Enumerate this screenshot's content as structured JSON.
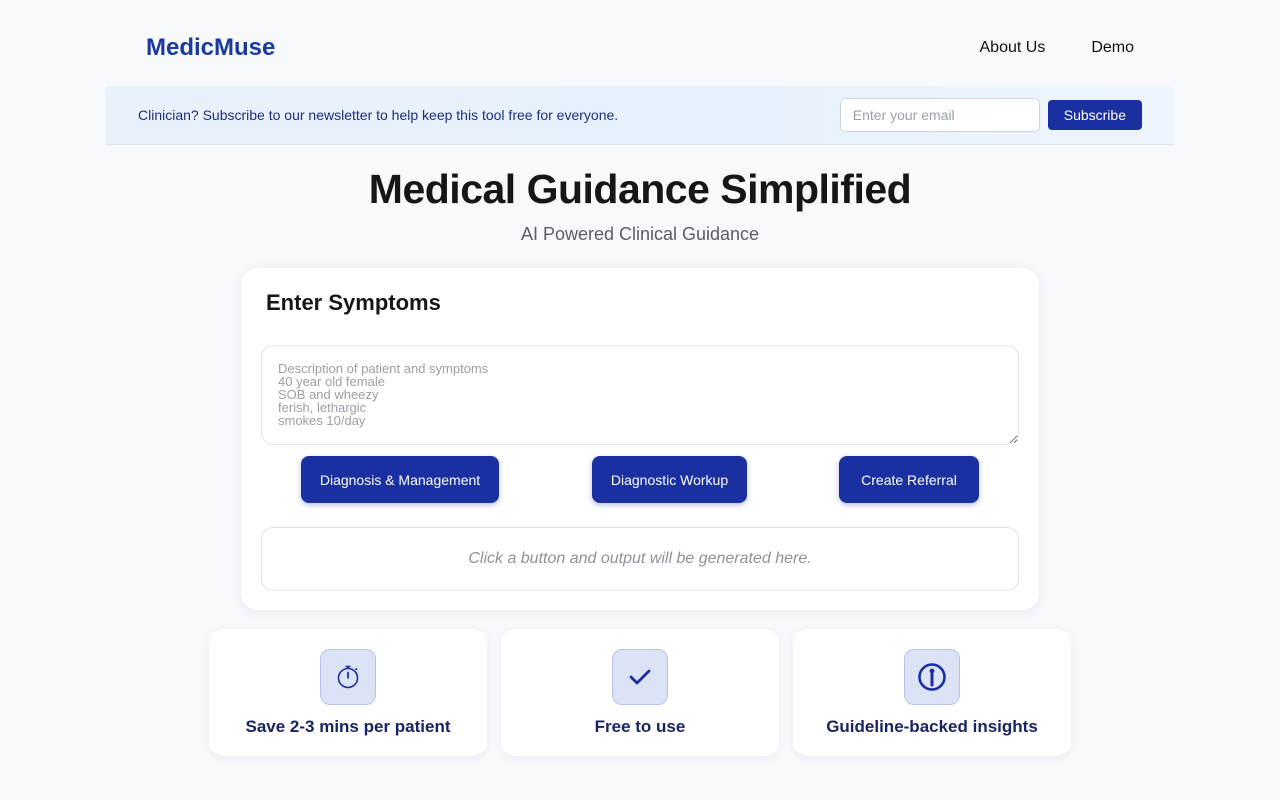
{
  "header": {
    "brand": "MedicMuse",
    "nav": [
      {
        "label": "About Us"
      },
      {
        "label": "Demo"
      }
    ]
  },
  "newsletter": {
    "text": "Clinician? Subscribe to our newsletter to help keep this tool free for everyone.",
    "email_placeholder": "Enter your email",
    "subscribe_label": "Subscribe"
  },
  "hero": {
    "title": "Medical Guidance Simplified",
    "subtitle": "AI Powered Clinical Guidance"
  },
  "symptoms_card": {
    "title": "Enter Symptoms",
    "textarea_placeholder": "Description of patient and symptoms\n40 year old female\nSOB and wheezy\nferish, lethargic\nsmokes 10/day",
    "buttons": [
      {
        "label": "Diagnosis & Management"
      },
      {
        "label": "Diagnostic Workup"
      },
      {
        "label": "Create Referral"
      }
    ],
    "output_placeholder": "Click a button and output will be generated here."
  },
  "features": [
    {
      "icon": "stopwatch-icon",
      "label": "Save 2-3 mins per patient"
    },
    {
      "icon": "checkmark-icon",
      "label": "Free to use"
    },
    {
      "icon": "info-icon",
      "label": "Guideline-backed insights"
    }
  ],
  "colors": {
    "brand": "#1a3a9c",
    "button": "#1a2fa0",
    "feature_text": "#1a2363"
  }
}
